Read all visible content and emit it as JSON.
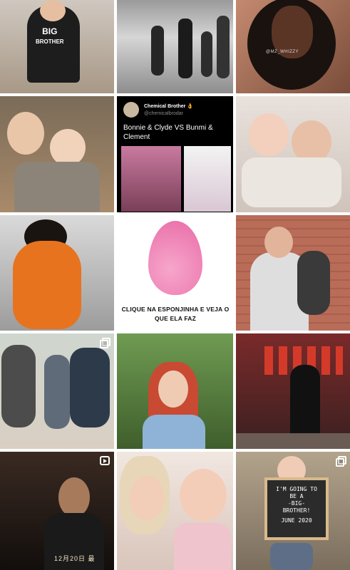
{
  "grid": {
    "tiles": [
      {
        "id": "post-1",
        "description": "toddler big brother",
        "bg": "#bfb3a4"
      },
      {
        "id": "post-2",
        "description": "family beach walk",
        "bg": "#7d7d7d"
      },
      {
        "id": "post-3",
        "description": "portrait woman",
        "bg": "#6b4f3c"
      },
      {
        "id": "post-4",
        "description": "boy holding baby",
        "bg": "#8b6f54"
      },
      {
        "id": "post-5",
        "description": "tweet screenshot",
        "bg": "#000000"
      },
      {
        "id": "post-6",
        "description": "two babies",
        "bg": "#dcd3cc"
      },
      {
        "id": "post-7",
        "description": "woman orange dress",
        "bg": "#b9b9b9"
      },
      {
        "id": "post-8",
        "description": "pink sponge ad",
        "bg": "#ffffff"
      },
      {
        "id": "post-9",
        "description": "mom with toddler brick wall",
        "bg": "#b66a55"
      },
      {
        "id": "post-10",
        "description": "family squatting",
        "bg": "#d8d3cb"
      },
      {
        "id": "post-11",
        "description": "woman red hair horns",
        "bg": "#5d7f3e"
      },
      {
        "id": "post-12",
        "description": "martial arts street",
        "bg": "#5a2424"
      },
      {
        "id": "post-13",
        "description": "movie still",
        "bg": "#1f1714"
      },
      {
        "id": "post-14",
        "description": "mother and baby",
        "bg": "#e7d7cf"
      },
      {
        "id": "post-15",
        "description": "child with letter board",
        "bg": "#9c8c74"
      }
    ]
  },
  "texts": {
    "shirt": "BIG",
    "shirt_sub": "BROTHER",
    "watermark_3": "@MZ_WHIZZY",
    "tweet_name": "Chemical Brother 👌",
    "tweet_handle": "@chemicalbrodar",
    "tweet_body": "Bonnie & Clyde VS Bunmi & Clement",
    "sponge_caption": "CLIQUE NA ESPONJINHA E VEJA O QUE ELA FAZ",
    "movie_subtitle": "12月20日 最",
    "board_lines": [
      "I'M GOING TO",
      "BE A",
      "-BIG-",
      "BROTHER!",
      "JUNE 2020"
    ]
  },
  "colors": {
    "sponge": "#f07fb4",
    "accent_orange": "#e8731f",
    "red_hair": "#c94a32"
  }
}
